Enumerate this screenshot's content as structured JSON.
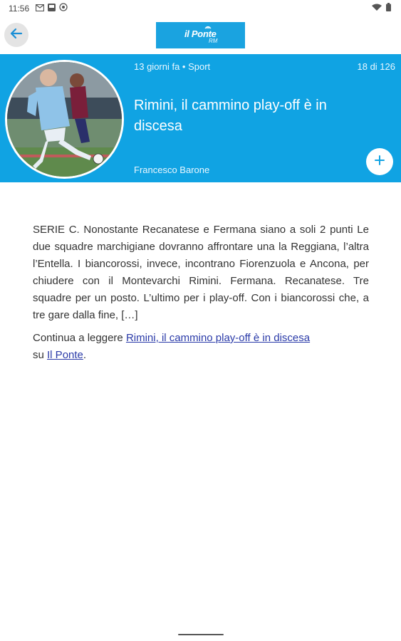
{
  "status_bar": {
    "time": "11:56",
    "left_icons": [
      "gmail-icon",
      "photo-icon",
      "camera-icon"
    ],
    "right_icons": [
      "wifi-icon",
      "battery-icon"
    ]
  },
  "app_bar": {
    "back_icon": "arrow-left-icon",
    "logo_text": "il Ponte",
    "logo_sub": "RM"
  },
  "article": {
    "meta": "13 giorni fa • Sport",
    "counter": "18 di 126",
    "title": "Rimini, il cammino play-off è in discesa",
    "author": "Francesco Barone",
    "paragraph": "SERIE C. Nonostante Recanatese e Fermana siano a soli 2 punti Le due squadre marchigiane dovranno affrontare una la Reggiana, l’altra l’Entella. I biancorossi, invece, incontrano Fiorenzuola e Ancona, per chiudere con il Montevarchi Rimini. Fermana. Recanatese. Tre squadre per un posto. L’ultimo per i play-off. Con i biancorossi che, a tre gare dalla fine, […]",
    "continue_prefix": "Continua a leggere ",
    "continue_link": "Rimini, il cammino play-off è in discesa",
    "continue_mid": " su ",
    "source_link": "Il Ponte",
    "continue_suffix": "."
  },
  "colors": {
    "accent": "#10a3e3",
    "link": "#2a3aa8"
  }
}
